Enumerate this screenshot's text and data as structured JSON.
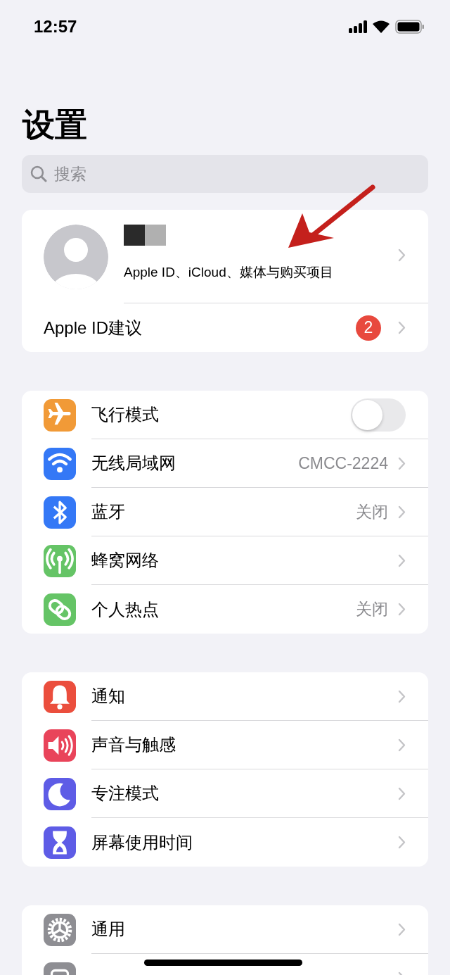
{
  "status_bar": {
    "time": "12:57"
  },
  "title": "设置",
  "search": {
    "placeholder": "搜索"
  },
  "profile": {
    "subtitle": "Apple ID、iCloud、媒体与购买项目",
    "suggestion": {
      "label": "Apple ID建议",
      "badge": "2"
    }
  },
  "groups": [
    [
      {
        "kind": "toggle",
        "color": "#f19a37",
        "label": "飞行模式",
        "on": false
      },
      {
        "kind": "link",
        "color": "#3478f6",
        "label": "无线局域网",
        "value": "CMCC-2224"
      },
      {
        "kind": "link",
        "color": "#3478f6",
        "label": "蓝牙",
        "value": "关闭"
      },
      {
        "kind": "link",
        "color": "#65c466",
        "label": "蜂窝网络"
      },
      {
        "kind": "link",
        "color": "#65c466",
        "label": "个人热点",
        "value": "关闭"
      }
    ],
    [
      {
        "kind": "link",
        "color": "#eb4e3d",
        "label": "通知"
      },
      {
        "kind": "link",
        "color": "#e9445a",
        "label": "声音与触感"
      },
      {
        "kind": "link",
        "color": "#5e5ce6",
        "label": "专注模式"
      },
      {
        "kind": "link",
        "color": "#5e5ce6",
        "label": "屏幕使用时间"
      }
    ],
    [
      {
        "kind": "link",
        "color": "#8e8e93",
        "label": "通用"
      },
      {
        "kind": "link",
        "color": "#8e8e93"
      }
    ]
  ]
}
